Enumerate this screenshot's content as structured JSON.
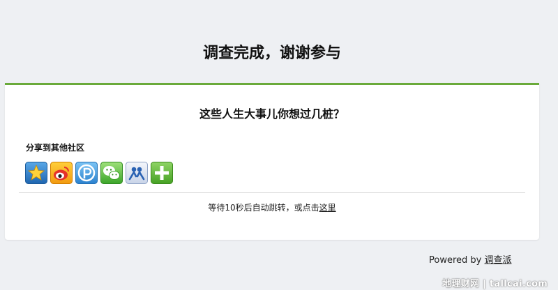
{
  "page": {
    "title": "调查完成，谢谢参与"
  },
  "card": {
    "question_title": "这些人生大事儿你想过几桩？",
    "share_label": "分享到其他社区",
    "share_buttons": [
      {
        "icon": "star-favorite-icon",
        "color": "#2f7fc4"
      },
      {
        "icon": "weibo-icon",
        "color": "#e24a2a"
      },
      {
        "icon": "p-logo-icon",
        "color": "#3a8fd6"
      },
      {
        "icon": "wechat-icon",
        "color": "#4fb53a"
      },
      {
        "icon": "people-icon",
        "color": "#2a62b3"
      },
      {
        "icon": "plus-icon",
        "color": "#5bb436"
      }
    ],
    "redirect_prefix": "等待10秒后自动跳转，或点击",
    "redirect_link": "这里"
  },
  "footer": {
    "powered_prefix": "Powered by ",
    "powered_link": "调查派"
  },
  "watermark": {
    "text": "地理财网 | tallcai.com"
  },
  "colors": {
    "accent_green": "#6aaa3a",
    "background": "#eef0f3"
  }
}
